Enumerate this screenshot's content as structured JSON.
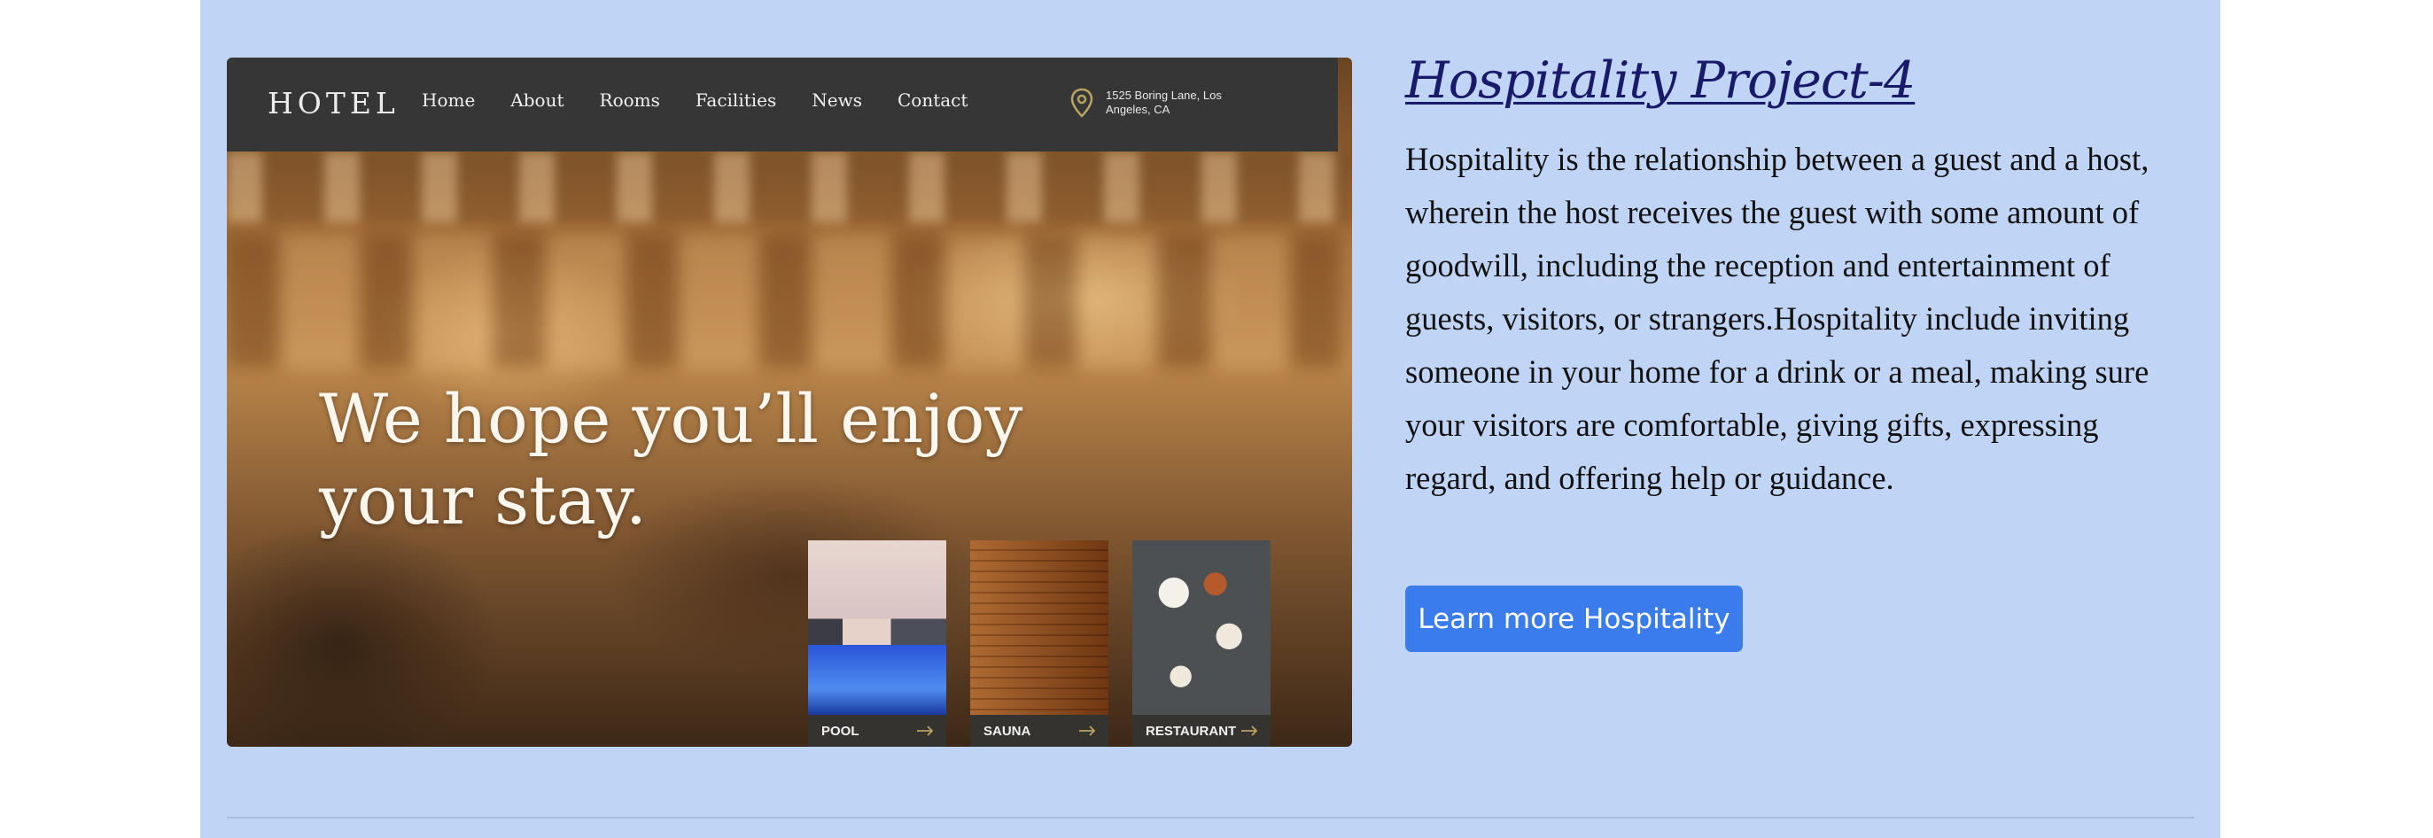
{
  "project": {
    "title": "Hospitality Project-4",
    "description": "Hospitality is the relationship between a guest and a host, wherein the host receives the guest with some amount of goodwill, including the reception and entertainment of guests, visitors, or strangers.Hospitality include inviting someone in your home for a drink or a meal, making sure your visitors are comfortable, giving gifts, expressing regard, and offering help or guidance.",
    "button_label": "Learn more Hospitality"
  },
  "preview": {
    "logo": "HOTEL",
    "nav": [
      "Home",
      "About",
      "Rooms",
      "Facilities",
      "News",
      "Contact"
    ],
    "address_line1": "1525 Boring Lane, Los",
    "address_line2": "Angeles, CA",
    "location_icon": "map-pin-icon",
    "hero_line1": "We hope you’ll enjoy",
    "hero_line2": "your stay.",
    "cards": [
      {
        "label": "POOL",
        "icon": "arrow-right-icon"
      },
      {
        "label": "SAUNA",
        "icon": "arrow-right-icon"
      },
      {
        "label": "RESTAURANT",
        "icon": "arrow-right-icon"
      }
    ]
  },
  "colors": {
    "panel_bg": "#c0d5f6",
    "title": "#1a1a6a",
    "button_bg": "#3b7ced",
    "preview_nav_bg": "#363636",
    "card_arrow": "#b8a361"
  }
}
